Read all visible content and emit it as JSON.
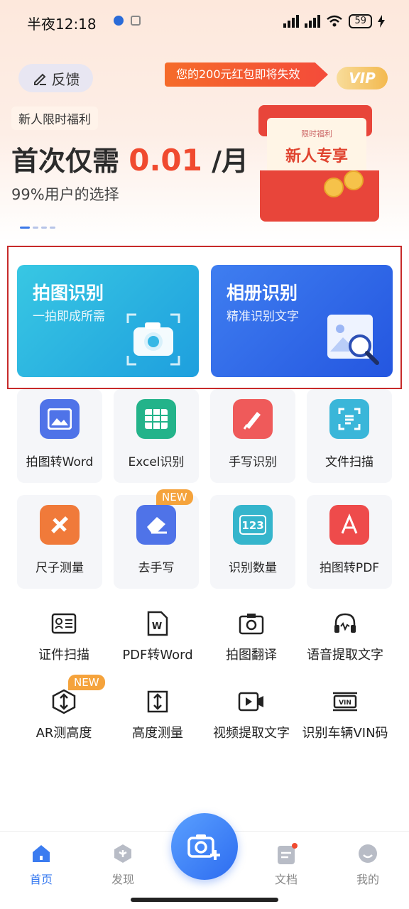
{
  "status_bar": {
    "time": "半夜12:18",
    "battery": "59"
  },
  "header": {
    "feedback_label": "反馈",
    "promo_text": "您的200元红包即将失效",
    "vip_label": "VIP",
    "new_user_tag": "新人限时福利",
    "headline_prefix": "首次仅需",
    "headline_price": "0.01",
    "headline_suffix": "/月",
    "subline": "99%用户的选择",
    "gift_card_top": "限时福利",
    "gift_card_main": "新人专享"
  },
  "main_cards": [
    {
      "title": "拍图识别",
      "subtitle": "一拍即成所需"
    },
    {
      "title": "相册识别",
      "subtitle": "精准识别文字"
    }
  ],
  "tools_row1": [
    {
      "label": "拍图转Word",
      "icon": "image-word-icon",
      "color": "#4f73e8"
    },
    {
      "label": "Excel识别",
      "icon": "excel-table-icon",
      "color": "#23b38a"
    },
    {
      "label": "手写识别",
      "icon": "pen-icon",
      "color": "#ef5a5a"
    },
    {
      "label": "文件扫描",
      "icon": "document-scan-icon",
      "color": "#3ab6d9"
    }
  ],
  "tools_row2": [
    {
      "label": "尺子测量",
      "icon": "ruler-icon",
      "color": "#f07a3a"
    },
    {
      "label": "去手写",
      "icon": "eraser-icon",
      "color": "#4f73e8",
      "badge": "NEW"
    },
    {
      "label": "识别数量",
      "icon": "count-123-icon",
      "color": "#35b5cc"
    },
    {
      "label": "拍图转PDF",
      "icon": "pdf-icon",
      "color": "#ee4b4b"
    }
  ],
  "tools_row3": [
    {
      "label": "证件扫描",
      "icon": "id-card-icon"
    },
    {
      "label": "PDF转Word",
      "icon": "pdf-to-word-icon"
    },
    {
      "label": "拍图翻译",
      "icon": "photo-translate-icon"
    },
    {
      "label": "语音提取文字",
      "icon": "headphones-icon"
    }
  ],
  "tools_row4": [
    {
      "label": "AR测高度",
      "icon": "ar-height-icon",
      "badge": "NEW"
    },
    {
      "label": "高度测量",
      "icon": "height-measure-icon"
    },
    {
      "label": "视频提取文字",
      "icon": "video-icon"
    },
    {
      "label": "识别车辆VIN码",
      "icon": "vin-code-icon"
    }
  ],
  "tabbar": [
    {
      "label": "首页",
      "icon": "home-icon",
      "active": true
    },
    {
      "label": "发现",
      "icon": "discover-icon"
    },
    {
      "label": "文档",
      "icon": "document-icon"
    },
    {
      "label": "我的",
      "icon": "profile-icon"
    }
  ],
  "colors": {
    "accent": "#3b7cf0",
    "price": "#f04a2f",
    "highlight_border": "#c72a2a"
  }
}
